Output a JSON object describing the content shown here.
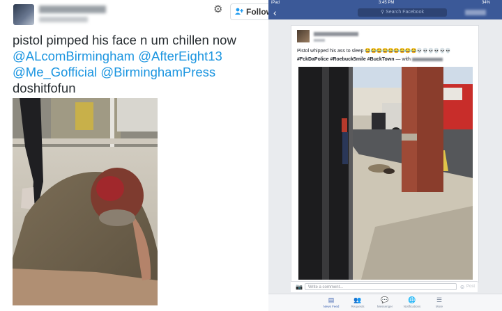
{
  "twitter": {
    "follow_label": "Follow",
    "tweet_parts": [
      {
        "text": "pistol pimped his face n um chillen now ",
        "mention": false
      },
      {
        "text": "@ALcomBirmingham",
        "mention": true
      },
      {
        "text": " ",
        "mention": false
      },
      {
        "text": "@AfterEight13",
        "mention": true
      },
      {
        "text": " ",
        "mention": false
      },
      {
        "text": "@Me_Gofficial",
        "mention": true
      },
      {
        "text": " ",
        "mention": false
      },
      {
        "text": "@BirminghamPress",
        "mention": true
      },
      {
        "text": " doshitfofun",
        "mention": false
      }
    ],
    "icons": [
      "gear-icon",
      "add-person-icon"
    ]
  },
  "facebook": {
    "status_left": "iPad",
    "status_time": "3:45 PM",
    "status_battery": "34%",
    "search_placeholder": "Search Facebook",
    "post_text": "Pistol whipped his ass to sleep",
    "post_emoji_laugh": "😂😂😂😂😂😂😂😂😂",
    "post_emoji_skull": "💀💀💀💀💀💀",
    "hashtags": "#FckDaPolice #Roebuck5mile #BuckTown",
    "with_label": "— with",
    "comment_placeholder": "Write a comment...",
    "post_button": "Post",
    "tabs": [
      {
        "label": "News Feed",
        "icon": "news-feed-icon",
        "active": true
      },
      {
        "label": "Requests",
        "icon": "friends-icon",
        "active": false
      },
      {
        "label": "Messenger",
        "icon": "messenger-icon",
        "active": false
      },
      {
        "label": "Notifications",
        "icon": "globe-icon",
        "active": false
      },
      {
        "label": "More",
        "icon": "menu-icon",
        "active": false
      }
    ],
    "colors": {
      "brand": "#3b5998",
      "active_tab": "#4267b2"
    }
  }
}
